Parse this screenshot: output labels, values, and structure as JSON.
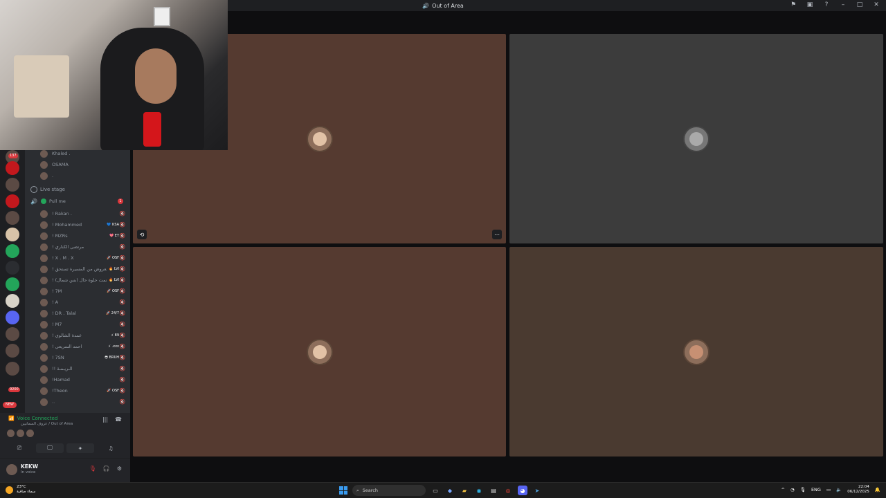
{
  "window": {
    "title": "Out of Area",
    "icons": [
      "flag-icon",
      "screen-icon",
      "help-icon",
      "minimize-icon",
      "maximize-icon",
      "close-icon"
    ]
  },
  "rail": {
    "badges": [
      "137",
      "2",
      "3",
      "3",
      "4",
      "1",
      "1",
      "1",
      "1",
      "1",
      "1",
      "1",
      "1",
      "1",
      "1",
      "1",
      "1",
      "33",
      "9200",
      "NEW"
    ]
  },
  "channels": {
    "top_users": [
      "Khaled .",
      "OSAMA",
      "."
    ],
    "stage_label": "Live stage",
    "pull_label": "Pull me",
    "pull_count": "1",
    "members": [
      {
        "name": "! Rakan .",
        "tag": ""
      },
      {
        "name": "! Mohammed",
        "tag": "💙 KSA"
      },
      {
        "name": "! MZRs",
        "tag": "💖 ET"
      },
      {
        "name": "! مرتضى الكناري",
        "tag": ""
      },
      {
        "name": "! X . M . X",
        "tag": "🚀 OSF"
      },
      {
        "name": "! المعروض من المسيرة تستحق",
        "tag": "🔥 LVI"
      },
      {
        "name": "! بانمت حلوة حال (بس شمال)",
        "tag": "🔥 LVI"
      },
      {
        "name": "! 7M",
        "tag": "🚀 OSF"
      },
      {
        "name": "! A",
        "tag": ""
      },
      {
        "name": "! DR . Talal",
        "tag": "🚀 24/7"
      },
      {
        "name": "! M7",
        "tag": ""
      },
      {
        "name": "! عمدة الشالوي",
        "tag": "⚡ 89"
      },
      {
        "name": "! احمد السريعي",
        "tag": "⚡ .xxx"
      },
      {
        "name": "! 7SN",
        "tag": "😎 BRUH"
      },
      {
        "name": "!! الـريـمـة",
        "tag": ""
      },
      {
        "name": "!Hamad",
        "tag": ""
      },
      {
        "name": "!Theon",
        "tag": "🚀 OSF"
      },
      {
        "name": "..",
        "tag": ""
      }
    ]
  },
  "voice": {
    "status": "Voice Connected",
    "location": "عزوف السمانيين / Out of Area"
  },
  "user": {
    "name": "KEKW",
    "status": "In voice"
  },
  "taskbar": {
    "weather_temp": "23°C",
    "weather_desc": "سماء صافية",
    "search_label": "Search",
    "lang": "ENG",
    "time": "22:04",
    "date": "06/12/2025"
  },
  "colors": {
    "tile_brown": "#553a30",
    "tile_gray": "#3c3c3c",
    "voice_green": "#23a55a",
    "alert_red": "#da373c"
  }
}
